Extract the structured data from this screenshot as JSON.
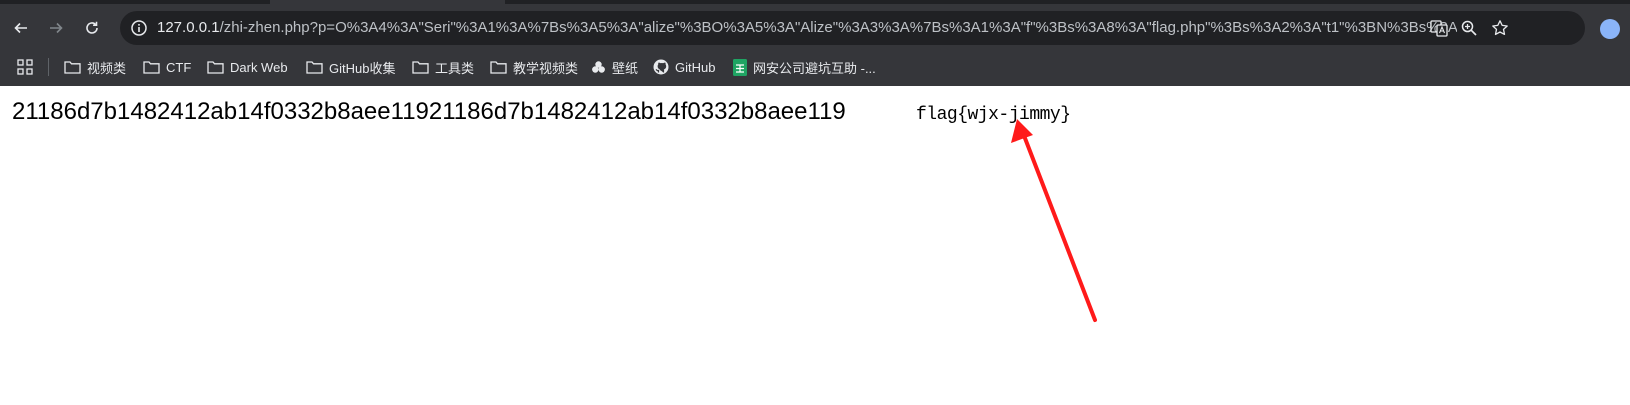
{
  "browser": {
    "url_host": "127.0.0.1",
    "url_rest": "/zhi-zhen.php?p=O%3A4%3A\"Seri\"%3A1%3A%7Bs%3A5%3A\"alize\"%3BO%3A5%3A\"Alize\"%3A3%3A%7Bs%3A1%3A\"f\"%3Bs%3A8%3A\"flag.php\"%3Bs%3A2%3A\"t1\"%3BN%3Bs%3A2%3...",
    "bookmarks": [
      {
        "label": "视频类",
        "icon": "folder-icon"
      },
      {
        "label": "CTF",
        "icon": "folder-icon"
      },
      {
        "label": "Dark Web",
        "icon": "folder-icon"
      },
      {
        "label": "GitHub收集",
        "icon": "folder-icon"
      },
      {
        "label": "工具类",
        "icon": "folder-icon"
      },
      {
        "label": "教学视频类",
        "icon": "folder-icon"
      },
      {
        "label": "壁纸",
        "icon": "clover-icon"
      },
      {
        "label": "GitHub",
        "icon": "github-icon"
      },
      {
        "label": "网安公司避坑互助 -...",
        "icon": "sheets-icon"
      }
    ]
  },
  "page": {
    "hash_text": "21186d7b1482412ab14f0332b8aee11921186d7b1482412ab14f0332b8aee119",
    "flag_text": "flag{wjx-jimmy}"
  },
  "colors": {
    "chrome_bg": "#35363a",
    "omnibox_bg": "#202124",
    "arrow": "#ff1a1a"
  }
}
